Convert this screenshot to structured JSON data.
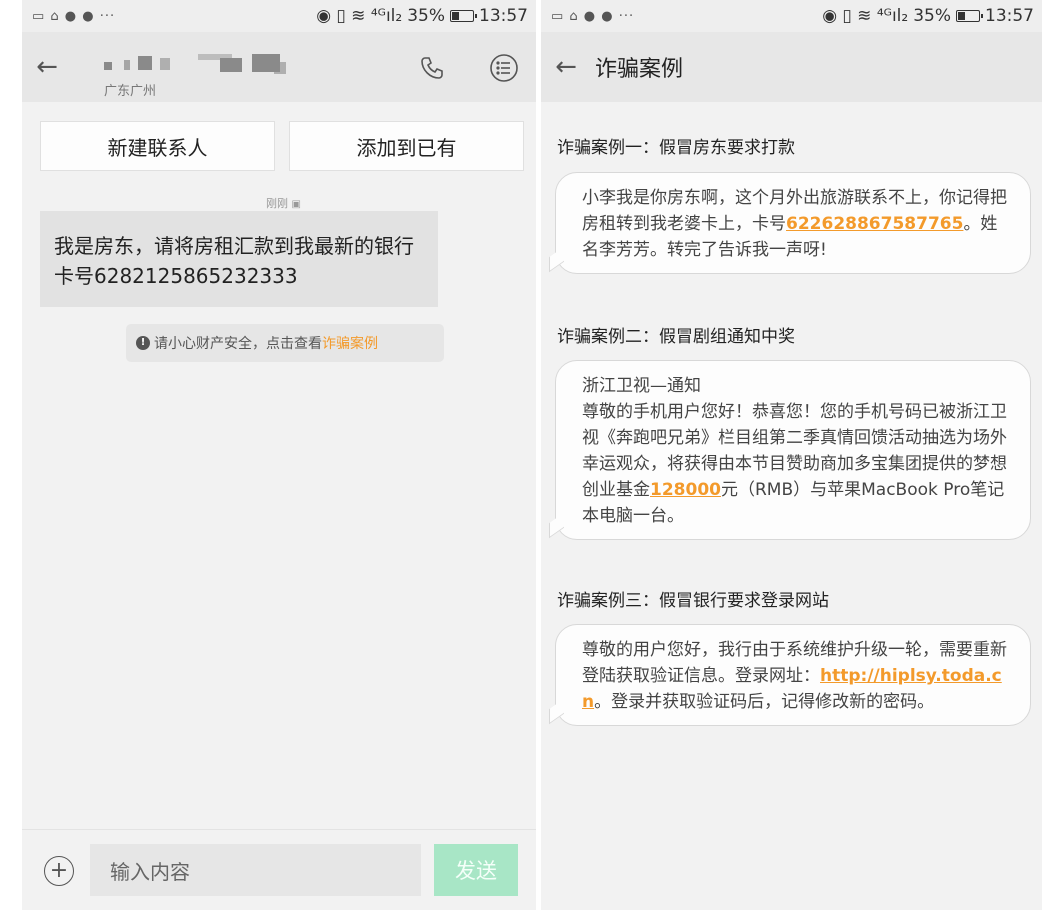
{
  "status_bar": {
    "left_icons": "▭ ⌂ ● ● ···",
    "signal": "◉ ▯ ≋ ⁴ᴳıl₂",
    "battery_percent": "35%",
    "battery_level": 0.35,
    "time": "13:57"
  },
  "left_screen": {
    "contact_location": "广东广州",
    "new_contact_label": "新建联系人",
    "add_existing_label": "添加到已有",
    "message_time": "刚刚",
    "message_text": "我是房东，请将房租汇款到我最新的银行卡号6282125865232333",
    "warning_prefix": "请小心财产安全，点击查看",
    "warning_link": "诈骗案例",
    "input_placeholder": "输入内容",
    "send_label": "发送"
  },
  "right_screen": {
    "title": "诈骗案例",
    "cases": [
      {
        "heading": "诈骗案例一：假冒房东要求打款",
        "text_before": "小李我是你房东啊，这个月外出旅游联系不上，你记得把房租转到我老婆卡上，卡号",
        "highlight": "622628867587765",
        "text_after": "。姓名李芳芳。转完了告诉我一声呀!"
      },
      {
        "heading": "诈骗案例二：假冒剧组通知中奖",
        "line1": "浙江卫视—通知",
        "text_before": "尊敬的手机用户您好！恭喜您！您的手机号码已被浙江卫视《奔跑吧兄弟》栏目组第二季真情回馈活动抽选为场外幸运观众，将获得由本节目赞助商加多宝集团提供的梦想创业基金",
        "highlight": "128000",
        "text_after": "元（RMB）与苹果MacBook Pro笔记本电脑一台。"
      },
      {
        "heading": "诈骗案例三：假冒银行要求登录网站",
        "text_before": "尊敬的用户您好，我行由于系统维护升级一轮，需要重新登陆获取验证信息。登录网址：",
        "highlight": "http://hiplsy.toda.cn",
        "text_after": "。登录并获取验证码后，记得修改新的密码。"
      }
    ]
  },
  "colors": {
    "accent_orange": "#f39a2b",
    "send_green": "#a8e6c6"
  }
}
